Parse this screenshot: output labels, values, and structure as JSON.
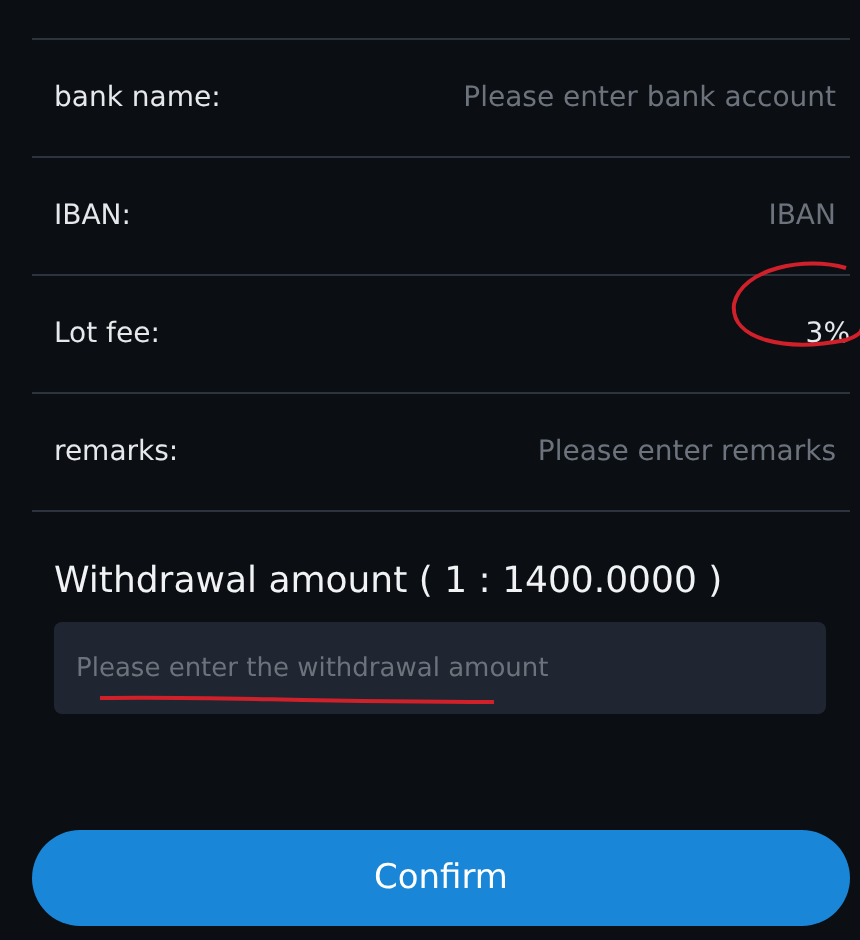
{
  "form_rows": [
    {
      "kind": "input",
      "label": "bank name:",
      "placeholder": "Please enter bank account"
    },
    {
      "kind": "input",
      "label": "IBAN:",
      "placeholder": "IBAN"
    },
    {
      "kind": "value",
      "label": "Lot fee:",
      "value": "3%",
      "circled": true
    },
    {
      "kind": "input",
      "label": "remarks:",
      "placeholder": "Please enter remarks"
    }
  ],
  "withdrawal": {
    "title": "Withdrawal amount ( 1 : 1400.0000 )",
    "placeholder": "Please enter the withdrawal amount",
    "underlined": true
  },
  "confirm_button": "Confirm"
}
